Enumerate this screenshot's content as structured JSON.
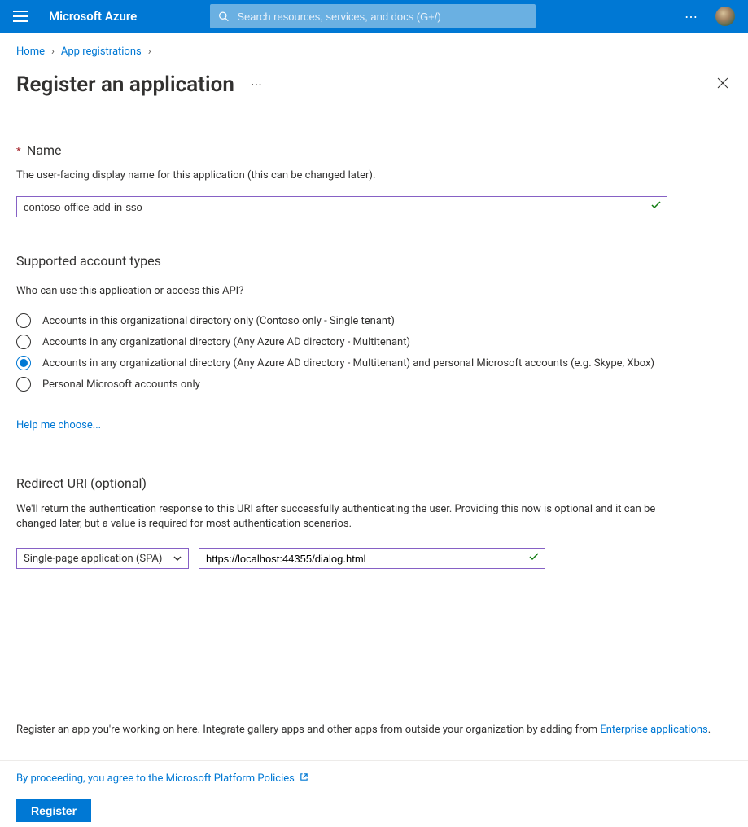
{
  "header": {
    "brand": "Microsoft Azure",
    "search_placeholder": "Search resources, services, and docs (G+/)"
  },
  "breadcrumbs": {
    "home": "Home",
    "app_reg": "App registrations"
  },
  "page": {
    "title": "Register an application"
  },
  "name_section": {
    "label": "Name",
    "desc": "The user-facing display name for this application (this can be changed later).",
    "value": "contoso-office-add-in-sso"
  },
  "accounts_section": {
    "heading": "Supported account types",
    "question": "Who can use this application or access this API?",
    "options": [
      "Accounts in this organizational directory only (Contoso only - Single tenant)",
      "Accounts in any organizational directory (Any Azure AD directory - Multitenant)",
      "Accounts in any organizational directory (Any Azure AD directory - Multitenant) and personal Microsoft accounts (e.g. Skype, Xbox)",
      "Personal Microsoft accounts only"
    ],
    "selected_index": 2,
    "help_link": "Help me choose..."
  },
  "redirect_section": {
    "heading": "Redirect URI (optional)",
    "desc": "We'll return the authentication response to this URI after successfully authenticating the user. Providing this now is optional and it can be changed later, but a value is required for most authentication scenarios.",
    "platform": "Single-page application (SPA)",
    "uri_value": "https://localhost:44355/dialog.html"
  },
  "footer": {
    "note_prefix": "Register an app you're working on here. Integrate gallery apps and other apps from outside your organization by adding from ",
    "note_link": "Enterprise applications",
    "policy_text": "By proceeding, you agree to the Microsoft Platform Policies",
    "register": "Register"
  }
}
